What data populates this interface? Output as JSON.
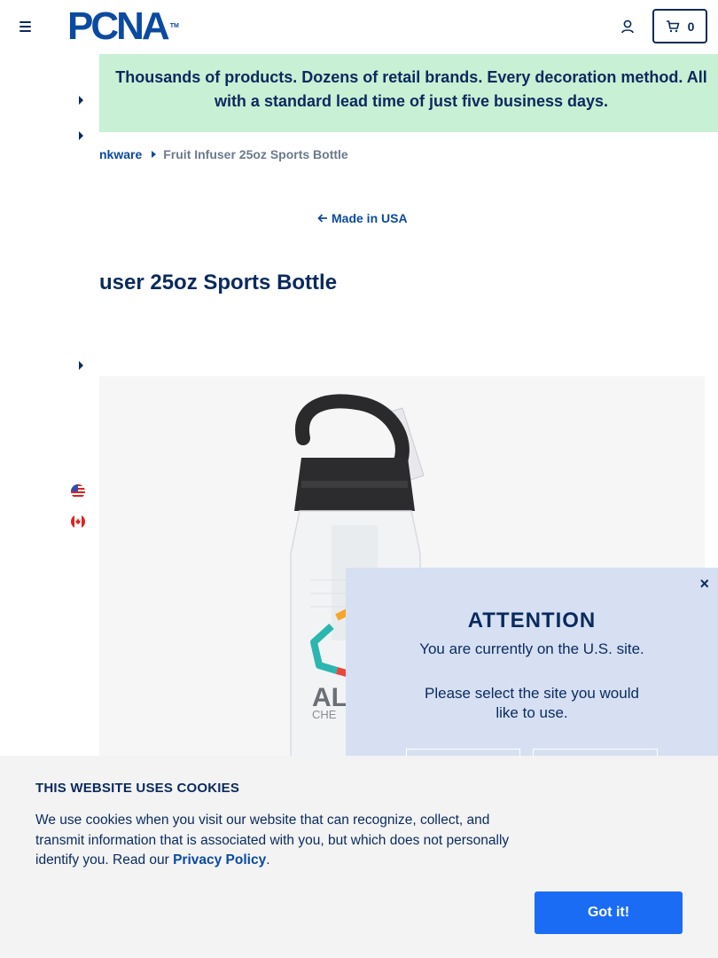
{
  "header": {
    "logo_text": "PCNA",
    "logo_tm": "TM",
    "cart_count": "0"
  },
  "banner": {
    "text": "Thousands of products. Dozens of retail brands. Every decoration method. All with a standard lead time of just five business days."
  },
  "breadcrumb": {
    "parent": "nkware",
    "current": "Fruit Infuser 25oz Sports Bottle"
  },
  "back_link": {
    "label": "Made in USA"
  },
  "product": {
    "title": "Fruit Infuser 25oz Sports Bottle",
    "title_visible": "user 25oz Sports Bottle",
    "imprint_text": "AL",
    "imprint_sub": "CHE"
  },
  "attention_modal": {
    "close": "×",
    "title": "ATTENTION",
    "message": "You are currently on the U.S. site.",
    "prompt": "Please select the site you would like to use."
  },
  "cookie_banner": {
    "title": "THIS WEBSITE USES COOKIES",
    "body": "We use cookies when you visit our website that can recognize, collect, and transmit information that is associated with you, but which does not personally identify you. Read our ",
    "link": "Privacy Policy",
    "end": ".",
    "button": "Got it!"
  },
  "icons": {
    "menu": "hamburger-icon",
    "account": "user-icon",
    "cart": "cart-icon",
    "back": "arrow-left-icon",
    "us_flag": "us-flag-icon",
    "ca_flag": "canada-flag-icon"
  },
  "colors": {
    "brand_navy": "#0a2a5e",
    "brand_blue": "#0b4aa0",
    "banner_green": "#c8f0d4",
    "modal_bg": "#d6e0f2",
    "button_blue": "#1b6cf4"
  }
}
